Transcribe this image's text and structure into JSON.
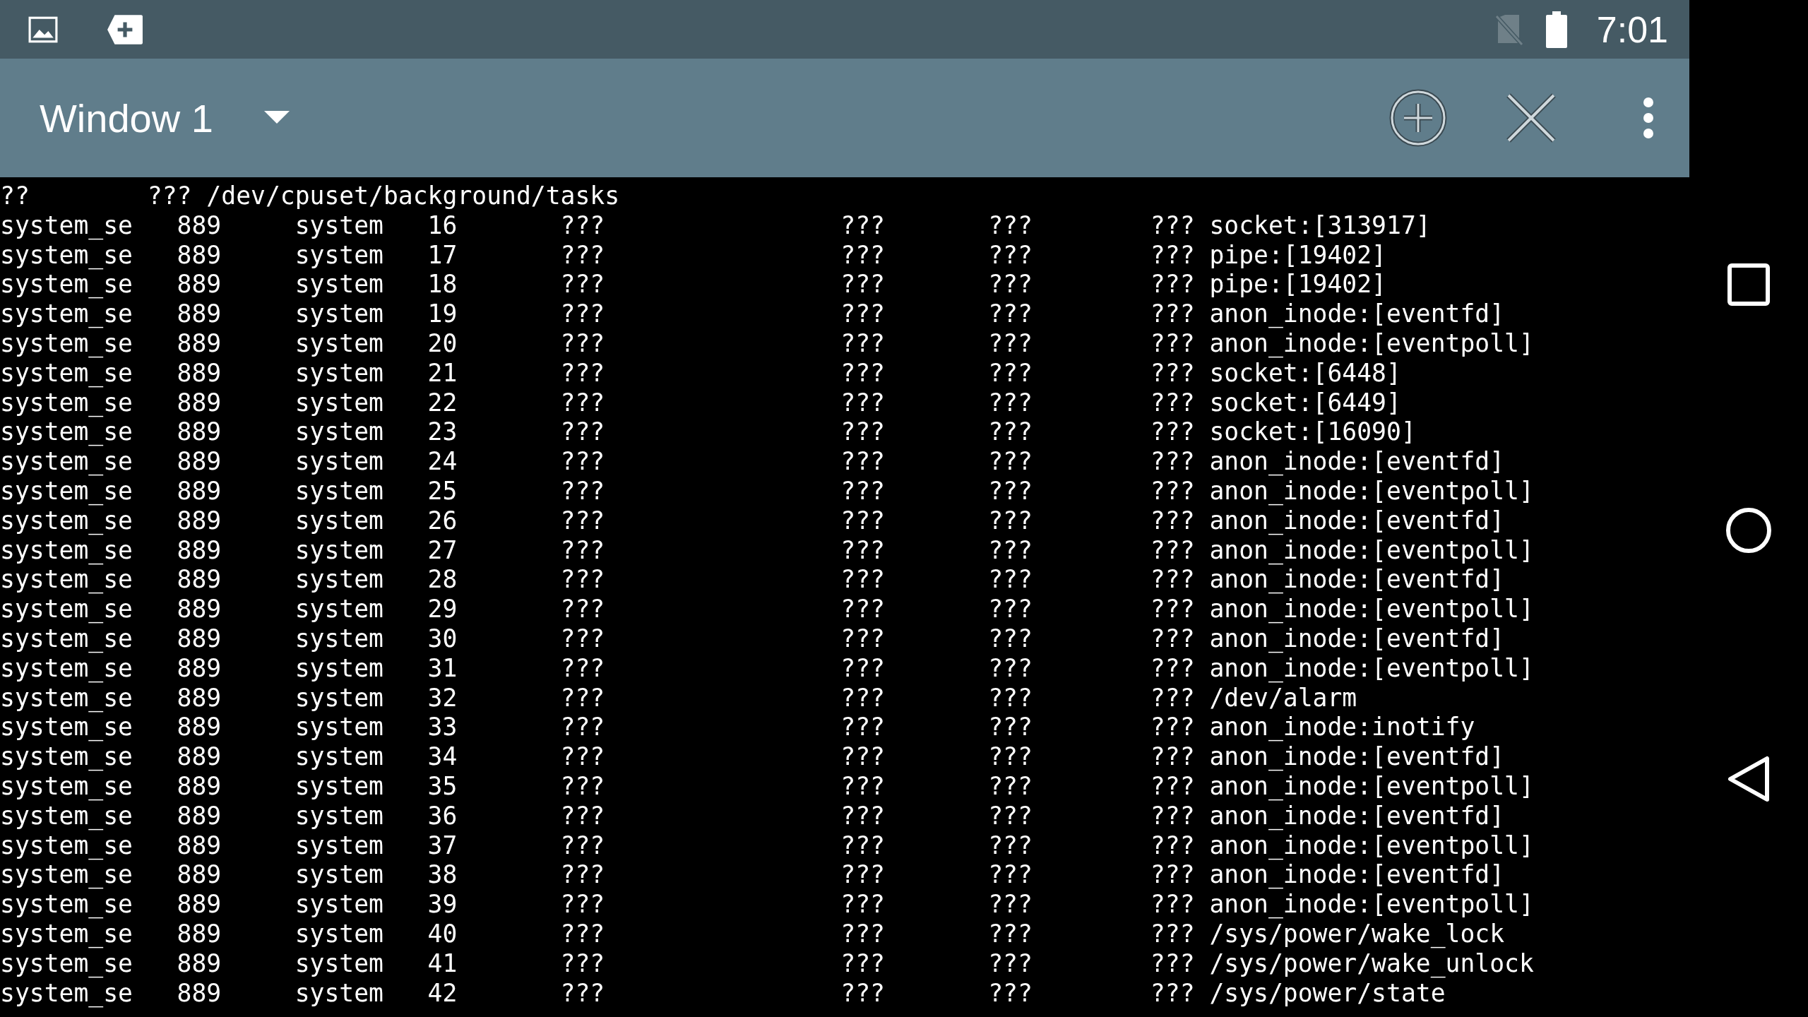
{
  "status_bar": {
    "time": "7:01"
  },
  "toolbar": {
    "title": "Window 1"
  },
  "terminal": {
    "partial_line": [
      "??",
      "???",
      "/dev/cpuset/background/tasks"
    ],
    "rows": [
      [
        "system_se",
        "889",
        "system",
        "16",
        "???",
        "???",
        "???",
        "???",
        "socket:[313917]"
      ],
      [
        "system_se",
        "889",
        "system",
        "17",
        "???",
        "???",
        "???",
        "???",
        "pipe:[19402]"
      ],
      [
        "system_se",
        "889",
        "system",
        "18",
        "???",
        "???",
        "???",
        "???",
        "pipe:[19402]"
      ],
      [
        "system_se",
        "889",
        "system",
        "19",
        "???",
        "???",
        "???",
        "???",
        "anon_inode:[eventfd]"
      ],
      [
        "system_se",
        "889",
        "system",
        "20",
        "???",
        "???",
        "???",
        "???",
        "anon_inode:[eventpoll]"
      ],
      [
        "system_se",
        "889",
        "system",
        "21",
        "???",
        "???",
        "???",
        "???",
        "socket:[6448]"
      ],
      [
        "system_se",
        "889",
        "system",
        "22",
        "???",
        "???",
        "???",
        "???",
        "socket:[6449]"
      ],
      [
        "system_se",
        "889",
        "system",
        "23",
        "???",
        "???",
        "???",
        "???",
        "socket:[16090]"
      ],
      [
        "system_se",
        "889",
        "system",
        "24",
        "???",
        "???",
        "???",
        "???",
        "anon_inode:[eventfd]"
      ],
      [
        "system_se",
        "889",
        "system",
        "25",
        "???",
        "???",
        "???",
        "???",
        "anon_inode:[eventpoll]"
      ],
      [
        "system_se",
        "889",
        "system",
        "26",
        "???",
        "???",
        "???",
        "???",
        "anon_inode:[eventfd]"
      ],
      [
        "system_se",
        "889",
        "system",
        "27",
        "???",
        "???",
        "???",
        "???",
        "anon_inode:[eventpoll]"
      ],
      [
        "system_se",
        "889",
        "system",
        "28",
        "???",
        "???",
        "???",
        "???",
        "anon_inode:[eventfd]"
      ],
      [
        "system_se",
        "889",
        "system",
        "29",
        "???",
        "???",
        "???",
        "???",
        "anon_inode:[eventpoll]"
      ],
      [
        "system_se",
        "889",
        "system",
        "30",
        "???",
        "???",
        "???",
        "???",
        "anon_inode:[eventfd]"
      ],
      [
        "system_se",
        "889",
        "system",
        "31",
        "???",
        "???",
        "???",
        "???",
        "anon_inode:[eventpoll]"
      ],
      [
        "system_se",
        "889",
        "system",
        "32",
        "???",
        "???",
        "???",
        "???",
        "/dev/alarm"
      ],
      [
        "system_se",
        "889",
        "system",
        "33",
        "???",
        "???",
        "???",
        "???",
        "anon_inode:inotify"
      ],
      [
        "system_se",
        "889",
        "system",
        "34",
        "???",
        "???",
        "???",
        "???",
        "anon_inode:[eventfd]"
      ],
      [
        "system_se",
        "889",
        "system",
        "35",
        "???",
        "???",
        "???",
        "???",
        "anon_inode:[eventpoll]"
      ],
      [
        "system_se",
        "889",
        "system",
        "36",
        "???",
        "???",
        "???",
        "???",
        "anon_inode:[eventfd]"
      ],
      [
        "system_se",
        "889",
        "system",
        "37",
        "???",
        "???",
        "???",
        "???",
        "anon_inode:[eventpoll]"
      ],
      [
        "system_se",
        "889",
        "system",
        "38",
        "???",
        "???",
        "???",
        "???",
        "anon_inode:[eventfd]"
      ],
      [
        "system_se",
        "889",
        "system",
        "39",
        "???",
        "???",
        "???",
        "???",
        "anon_inode:[eventpoll]"
      ],
      [
        "system_se",
        "889",
        "system",
        "40",
        "???",
        "???",
        "???",
        "???",
        "/sys/power/wake_lock"
      ],
      [
        "system_se",
        "889",
        "system",
        "41",
        "???",
        "???",
        "???",
        "???",
        "/sys/power/wake_unlock"
      ],
      [
        "system_se",
        "889",
        "system",
        "42",
        "???",
        "???",
        "???",
        "???",
        "/sys/power/state"
      ]
    ]
  }
}
